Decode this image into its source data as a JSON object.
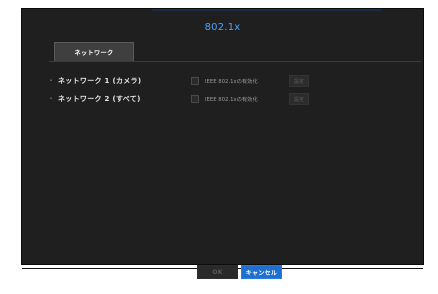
{
  "dialog": {
    "title": "802.1x"
  },
  "tabs": [
    {
      "label": "ネットワーク"
    }
  ],
  "rows": [
    {
      "label": "ネットワーク 1 (カメラ)",
      "checkbox_label": "IEEE 802.1xの有効化",
      "checked": false,
      "setting_label": "設定"
    },
    {
      "label": "ネットワーク 2 (すべて)",
      "checkbox_label": "IEEE 802.1xの有効化",
      "checked": false,
      "setting_label": "設定"
    }
  ],
  "buttons": {
    "ok_label": "OK",
    "cancel_label": "キャンセル"
  },
  "colors": {
    "title": "#4aa3ff",
    "accent": "#1f6fd1",
    "background": "#1f1f1f"
  }
}
